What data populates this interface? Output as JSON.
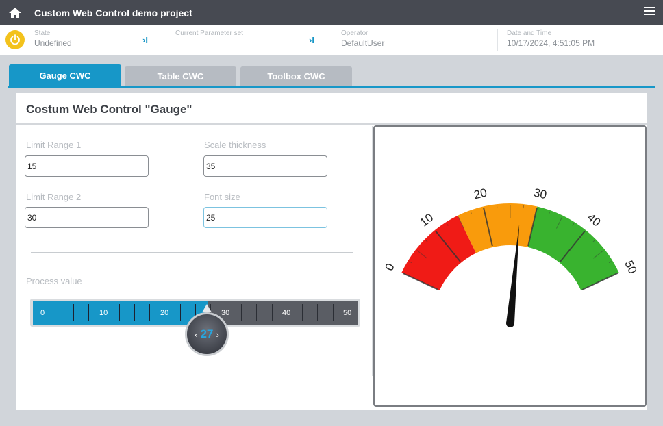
{
  "header": {
    "title": "Custom Web Control demo project"
  },
  "status": {
    "state_label": "State",
    "state_value": "Undefined",
    "paramset_label": "Current Parameter set",
    "paramset_value": "",
    "operator_label": "Operator",
    "operator_value": "DefaultUser",
    "datetime_label": "Date and Time",
    "datetime_value": "10/17/2024, 4:51:05 PM",
    "arrow_glyph": "›I"
  },
  "tabs": [
    {
      "label": "Gauge CWC",
      "active": true
    },
    {
      "label": "Table CWC",
      "active": false
    },
    {
      "label": "Toolbox CWC",
      "active": false
    }
  ],
  "panel": {
    "title": "Costum Web Control \"Gauge\"",
    "limit1_label": "Limit Range 1",
    "limit1_value": "15",
    "limit2_label": "Limit Range 2",
    "limit2_value": "30",
    "scale_label": "Scale thickness",
    "scale_value": "35",
    "font_label": "Font size",
    "font_value": "25",
    "process_label": "Process value"
  },
  "slider": {
    "min": 0,
    "max": 50,
    "value": 27,
    "display": "27",
    "tick_labels": [
      "0",
      "10",
      "20",
      "30",
      "40",
      "50"
    ]
  },
  "gauge": {
    "min": 0,
    "max": 50,
    "value": 27,
    "tick_labels": [
      "0",
      "10",
      "20",
      "30",
      "40",
      "50"
    ],
    "zones": [
      {
        "from": 0,
        "to": 15,
        "color": "#f01b16"
      },
      {
        "from": 15,
        "to": 30,
        "color": "#f99b0c"
      },
      {
        "from": 30,
        "to": 50,
        "color": "#39b32f"
      }
    ]
  },
  "colors": {
    "accent": "#1797c8",
    "power": "#f3c21c",
    "titlebar": "#474a52"
  }
}
